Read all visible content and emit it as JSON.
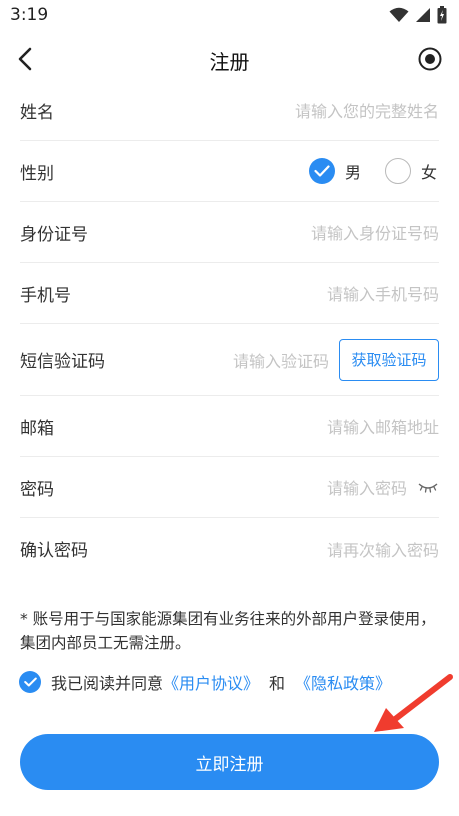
{
  "status_bar": {
    "time": "3:19"
  },
  "nav": {
    "title": "注册"
  },
  "form": {
    "name_label": "姓名",
    "name_placeholder": "请输入您的完整姓名",
    "gender_label": "性别",
    "gender_male": "男",
    "gender_female": "女",
    "gender_selected": "男",
    "id_label": "身份证号",
    "id_placeholder": "请输入身份证号码",
    "phone_label": "手机号",
    "phone_placeholder": "请输入手机号码",
    "sms_label": "短信验证码",
    "sms_placeholder": "请输入验证码",
    "sms_button": "获取验证码",
    "email_label": "邮箱",
    "email_placeholder": "请输入邮箱地址",
    "password_label": "密码",
    "password_placeholder": "请输入密码",
    "confirm_label": "确认密码",
    "confirm_placeholder": "请再次输入密码"
  },
  "notice": "* 账号用于与国家能源集团有业务往来的外部用户登录使用，集团内部员工无需注册。",
  "agreement": {
    "checked": true,
    "prefix": "我已阅读并同意",
    "user_agreement": "《用户协议》",
    "and": "和",
    "privacy_policy": "《隐私政策》"
  },
  "submit_label": "立即注册",
  "colors": {
    "accent": "#2a8cf2",
    "annotation_arrow": "#f03c2e"
  },
  "icons": [
    "wifi-icon",
    "signal-icon",
    "battery-icon",
    "back-icon",
    "record-icon",
    "check-icon",
    "eye-closed-icon"
  ]
}
